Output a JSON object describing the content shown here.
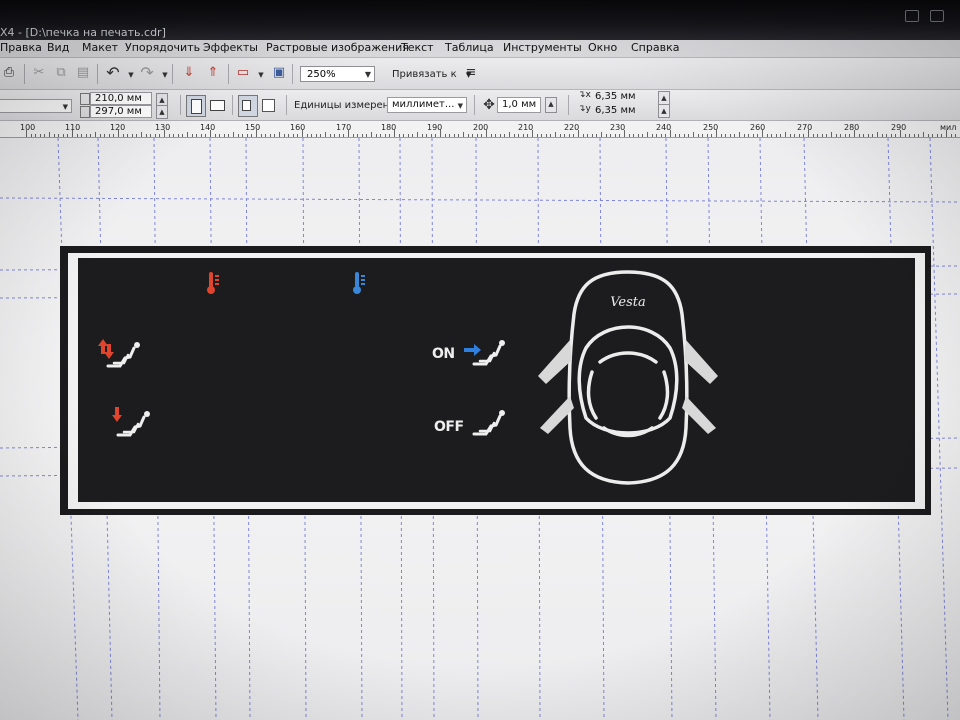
{
  "window": {
    "title": "X4 - [D:\\печка на печать.cdr]"
  },
  "menu": {
    "items": [
      "Правка",
      "Вид",
      "Макет",
      "Упорядочить",
      "Эффекты",
      "Растровые изображения",
      "Текст",
      "Таблица",
      "Инструменты",
      "Окно",
      "Справка"
    ]
  },
  "toolbar": {
    "zoom_value": "250%",
    "snap_label": "Привязать к",
    "icons": [
      "print-icon",
      "cut-icon",
      "copy-icon",
      "paste-icon",
      "undo-icon",
      "redo-icon",
      "import-icon",
      "export-icon",
      "publish-pdf-icon",
      "app-launcher-icon",
      "snap-options-icon"
    ]
  },
  "property_bar": {
    "width_value": "210,0 мм",
    "height_value": "297,0 мм",
    "units_label": "Единицы измерения:",
    "units_value": "миллимет...",
    "nudge_value": "1,0 мм",
    "dup_x_value": "6,35 мм",
    "dup_y_value": "6,35 мм"
  },
  "ruler": {
    "labels": [
      "100",
      "110",
      "120",
      "130",
      "140",
      "150",
      "160",
      "170",
      "180",
      "190",
      "200",
      "210",
      "220",
      "230",
      "240",
      "250",
      "260",
      "270",
      "280",
      "290",
      "мил"
    ]
  },
  "design": {
    "on_label": "ON",
    "off_label": "OFF",
    "car_badge": "Vesta",
    "colors": {
      "panel": "#1c1c1e",
      "hot": "#e0442c",
      "cold": "#3a86d8",
      "blue_arrow": "#2f7fe0",
      "icon_white": "#eeeeee"
    },
    "icons": [
      "thermometer-hot-icon",
      "thermometer-cold-icon",
      "seat-airflow-up-down-icon",
      "seat-airflow-down-icon",
      "seat-recirculation-on-icon",
      "seat-recirculation-off-icon",
      "car-top-view-icon"
    ]
  }
}
